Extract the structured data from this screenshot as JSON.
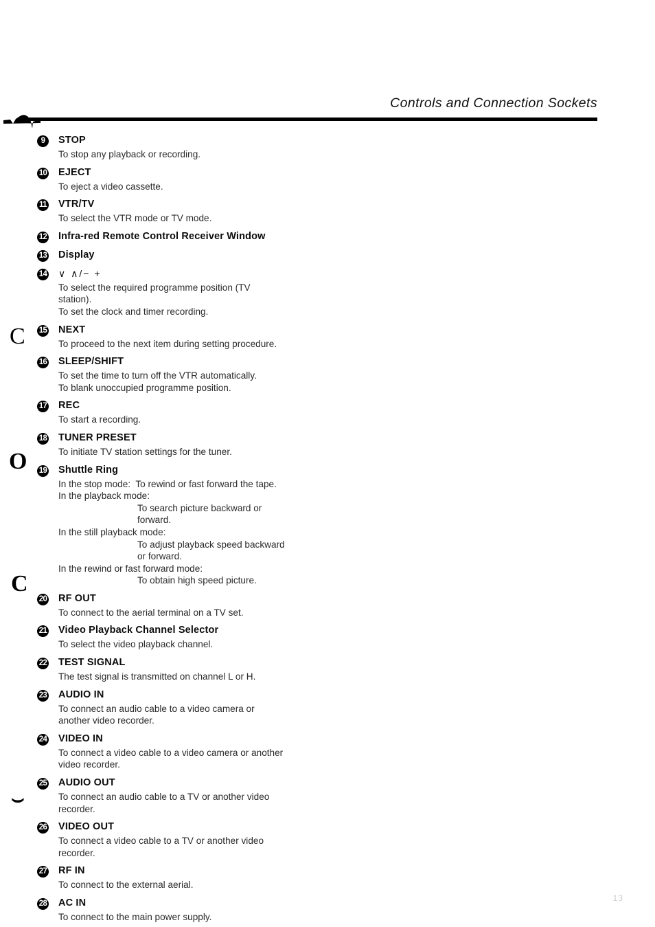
{
  "header": {
    "title": "Controls and Connection Sockets"
  },
  "page_number": "13",
  "margin_marks": {
    "squiggle": "~",
    "c_upper": "C",
    "o_mark": "O",
    "c_lower": "C",
    "v_mark": "⌣"
  },
  "entries": [
    {
      "number": "9",
      "title": "STOP",
      "lines": [
        {
          "text": "To stop any playback or recording.",
          "indent": false
        }
      ]
    },
    {
      "number": "10",
      "title": "EJECT",
      "lines": [
        {
          "text": "To eject a video cassette.",
          "indent": false
        }
      ]
    },
    {
      "number": "11",
      "title": "VTR/TV",
      "lines": [
        {
          "text": "To select the VTR mode or TV mode.",
          "indent": false
        }
      ]
    },
    {
      "number": "12",
      "title": "Infra-red Remote Control Receiver Window",
      "lines": []
    },
    {
      "number": "13",
      "title": "Display",
      "lines": []
    },
    {
      "number": "14",
      "title": "∨ ∧/− +",
      "title_is_symbols": true,
      "lines": [
        {
          "text": "To select the required programme position (TV",
          "indent": false
        },
        {
          "text": "station).",
          "indent": false
        },
        {
          "text": "To set the clock and timer recording.",
          "indent": false
        }
      ]
    },
    {
      "number": "15",
      "title": "NEXT",
      "lines": [
        {
          "text": "To proceed to the next item during setting procedure.",
          "indent": false
        }
      ]
    },
    {
      "number": "16",
      "title": "SLEEP/SHIFT",
      "lines": [
        {
          "text": "To set the time to turn off the VTR automatically.",
          "indent": false
        },
        {
          "text": "To blank unoccupied programme position.",
          "indent": false
        }
      ]
    },
    {
      "number": "17",
      "title": "REC",
      "lines": [
        {
          "text": "To start a recording.",
          "indent": false
        }
      ]
    },
    {
      "number": "18",
      "title": "TUNER PRESET",
      "lines": [
        {
          "text": "To initiate TV station settings for the tuner.",
          "indent": false
        }
      ]
    },
    {
      "number": "19",
      "title": "Shuttle Ring",
      "lines": [
        {
          "text": "In the stop mode:  To rewind or fast forward the tape.",
          "indent": false
        },
        {
          "text": "In the playback mode:",
          "indent": false
        },
        {
          "text": "To search picture backward or",
          "indent": true
        },
        {
          "text": "forward.",
          "indent": true
        },
        {
          "text": "In the still playback mode:",
          "indent": false
        },
        {
          "text": "To adjust playback speed backward",
          "indent": true
        },
        {
          "text": "or forward.",
          "indent": true
        },
        {
          "text": "In the rewind or fast forward mode:",
          "indent": false
        },
        {
          "text": "To obtain high speed picture.",
          "indent": true
        }
      ]
    },
    {
      "number": "20",
      "title": "RF OUT",
      "lines": [
        {
          "text": "To connect to the aerial terminal on a TV set.",
          "indent": false
        }
      ]
    },
    {
      "number": "21",
      "title": "Video Playback Channel Selector",
      "lines": [
        {
          "text": "To select the video playback channel.",
          "indent": false
        }
      ]
    },
    {
      "number": "22",
      "title": "TEST SIGNAL",
      "lines": [
        {
          "text": "The test signal is transmitted on channel L or H.",
          "indent": false
        }
      ]
    },
    {
      "number": "23",
      "title": "AUDIO IN",
      "lines": [
        {
          "text": "To connect an audio cable to a video camera or",
          "indent": false
        },
        {
          "text": "another video recorder.",
          "indent": false
        }
      ]
    },
    {
      "number": "24",
      "title": "VIDEO IN",
      "lines": [
        {
          "text": "To connect a video cable to a video camera or another",
          "indent": false
        },
        {
          "text": "video recorder.",
          "indent": false
        }
      ]
    },
    {
      "number": "25",
      "title": "AUDIO OUT",
      "lines": [
        {
          "text": "To connect an audio cable to a TV or another video",
          "indent": false
        },
        {
          "text": "recorder.",
          "indent": false
        }
      ]
    },
    {
      "number": "26",
      "title": "VIDEO OUT",
      "lines": [
        {
          "text": "To connect a video cable to a TV or another video",
          "indent": false
        },
        {
          "text": "recorder.",
          "indent": false
        }
      ]
    },
    {
      "number": "27",
      "title": "RF IN",
      "lines": [
        {
          "text": "To connect to the external aerial.",
          "indent": false
        }
      ]
    },
    {
      "number": "28",
      "title": "AC IN",
      "lines": [
        {
          "text": "To connect to the main power supply.",
          "indent": false
        }
      ]
    }
  ]
}
